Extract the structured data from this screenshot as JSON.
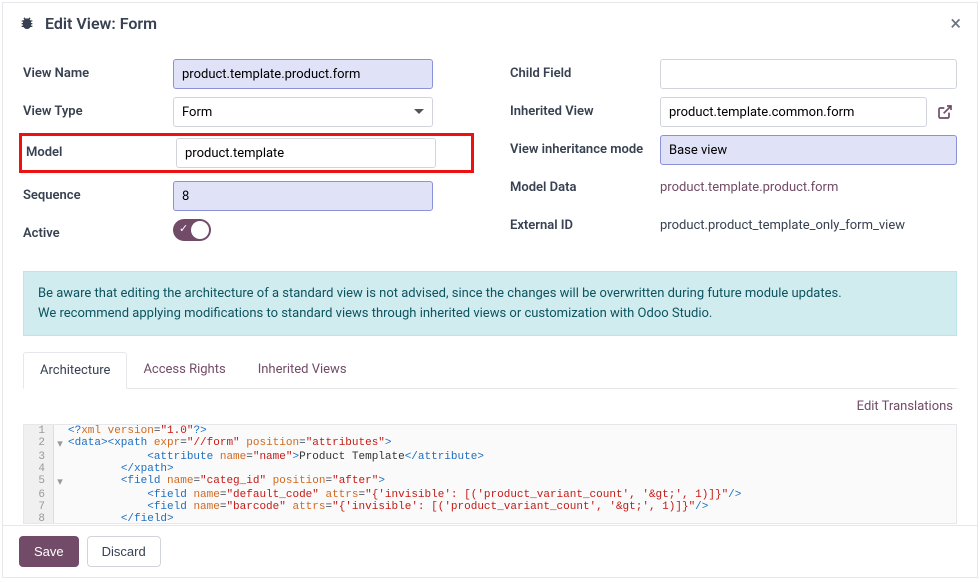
{
  "header": {
    "title": "Edit View: Form"
  },
  "left": {
    "view_name": {
      "label": "View Name",
      "value": "product.template.product.form"
    },
    "view_type": {
      "label": "View Type",
      "value": "Form"
    },
    "model": {
      "label": "Model",
      "value": "product.template"
    },
    "sequence": {
      "label": "Sequence",
      "value": "8"
    },
    "active": {
      "label": "Active"
    }
  },
  "right": {
    "child_field": {
      "label": "Child Field",
      "value": ""
    },
    "inherited_view": {
      "label": "Inherited View",
      "value": "product.template.common.form"
    },
    "inherit_mode": {
      "label": "View inheritance mode",
      "value": "Base view"
    },
    "model_data": {
      "label": "Model Data",
      "value": "product.template.product.form"
    },
    "external_id": {
      "label": "External ID",
      "value": "product.product_template_only_form_view"
    }
  },
  "alert": {
    "line1": "Be aware that editing the architecture of a standard view is not advised, since the changes will be overwritten during future module updates.",
    "line2": "We recommend applying modifications to standard views through inherited views or customization with Odoo Studio."
  },
  "tabs": {
    "t1": "Architecture",
    "t2": "Access Rights",
    "t3": "Inherited Views"
  },
  "edit_translations": "Edit Translations",
  "code": {
    "l1": "<?xml version=\"1.0\"?>",
    "l2": "<data><xpath expr=\"//form\" position=\"attributes\">",
    "l3": "            <attribute name=\"name\">Product Template</attribute>",
    "l4": "        </xpath>",
    "l5": "        <field name=\"categ_id\" position=\"after\">",
    "l6": "            <field name=\"default_code\" attrs=\"{'invisible': [('product_variant_count', '&gt;', 1)]}\"/>",
    "l7": "            <field name=\"barcode\" attrs=\"{'invisible': [('product_variant_count', '&gt;', 1)]}\"/>",
    "l8": "        </field>"
  },
  "footer": {
    "save": "Save",
    "discard": "Discard"
  }
}
